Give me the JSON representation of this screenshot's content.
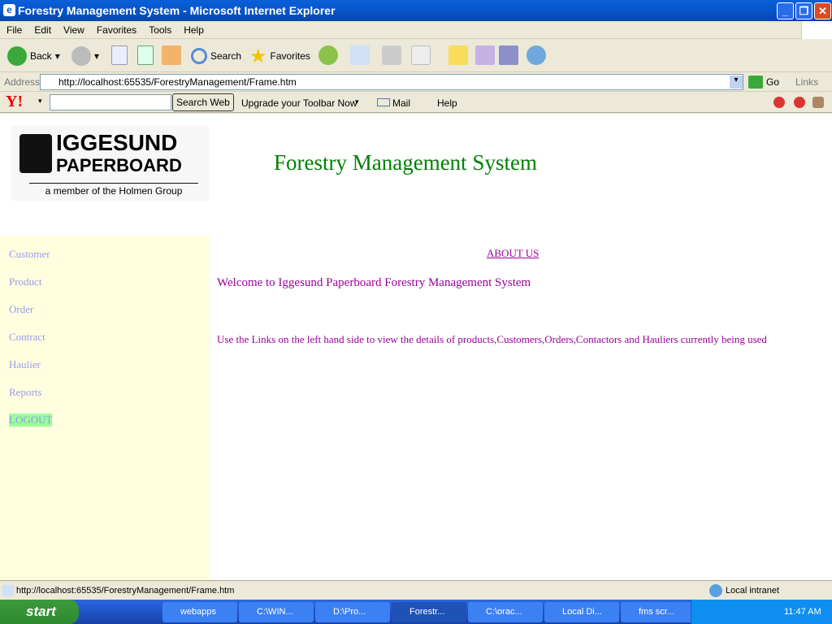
{
  "window": {
    "title": "Forestry Management System - Microsoft Internet Explorer"
  },
  "menu": [
    "File",
    "Edit",
    "View",
    "Favorites",
    "Tools",
    "Help"
  ],
  "toolbar": {
    "back": "Back",
    "search": "Search",
    "favorites": "Favorites"
  },
  "address": {
    "label": "Address",
    "url": "http://localhost:65535/ForestryManagement/Frame.htm",
    "go": "Go",
    "links": "Links"
  },
  "yahoo": {
    "logo": "Y!",
    "search_placeholder": "",
    "search_button": "Search Web",
    "upgrade": "Upgrade your Toolbar Now",
    "mail": "Mail",
    "help": "Help"
  },
  "page": {
    "logo": {
      "line1": "IGGESUND",
      "line2": "PAPERBOARD",
      "tagline": "a member of the Holmen Group"
    },
    "heading": "Forestry Management System",
    "nav": [
      "Customer",
      "Product",
      "Order",
      "Contract",
      "Haulier",
      "Reports",
      "LOGOUT"
    ],
    "about": "ABOUT US",
    "welcome": "Welcome to Iggesund Paperboard Forestry Management System",
    "instructions": "Use the Links on the left hand side to view the details of products,Customers,Orders,Contactors and Hauliers currently being used",
    "colors": {
      "heading": "#008000",
      "text": "#990099",
      "nav": "#9999ee",
      "sidebar_bg": "#ffffe0",
      "logout_bg": "#99ff99"
    }
  },
  "status": {
    "url": "http://localhost:65535/ForestryManagement/Frame.htm",
    "zone": "Local intranet"
  },
  "taskbar": {
    "start": "start",
    "tasks": [
      "webapps",
      "C:\\WIN...",
      "D:\\Pro...",
      "Forestr...",
      "C:\\orac...",
      "Local Di...",
      "fms scr..."
    ],
    "clock": "11:47 AM"
  }
}
